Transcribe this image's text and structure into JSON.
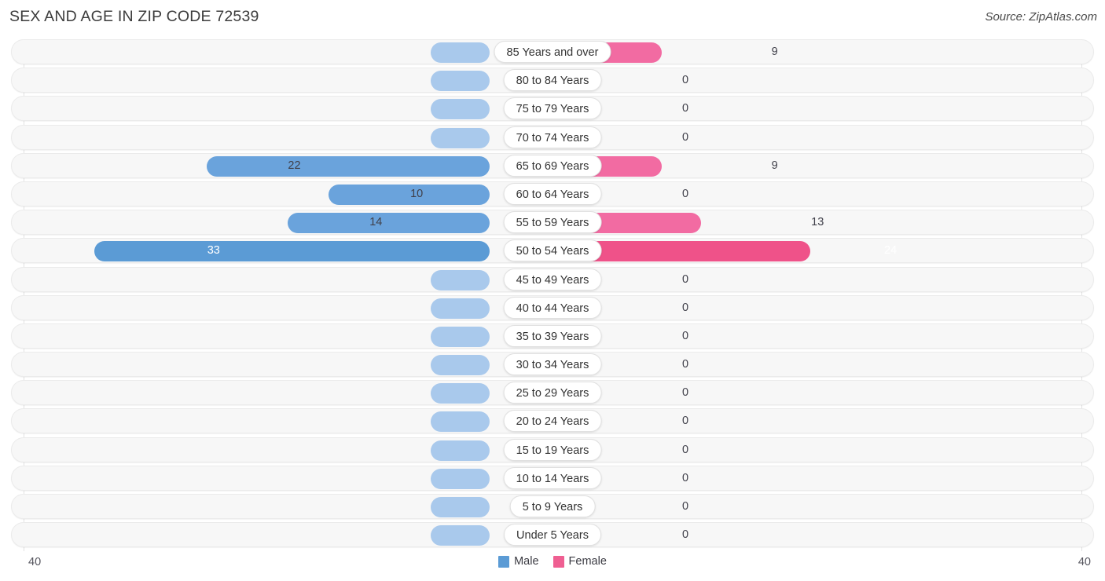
{
  "header": {
    "title": "SEX AND AGE IN ZIP CODE 72539",
    "source": "Source: ZipAtlas.com"
  },
  "legend": {
    "male_label": "Male",
    "female_label": "Female",
    "male_color": "#5b9bd5",
    "female_color": "#ef5f92"
  },
  "axis": {
    "left_max_label": "40",
    "right_max_label": "40"
  },
  "colors": {
    "male_strong": "#6aa3dc",
    "male_light": "#a9c9ec",
    "female_strong": "#f26ba2",
    "female_light": "#f7a9c4",
    "female_max": "#ef5289",
    "male_max": "#5b9bd5"
  },
  "chart_data": {
    "type": "bar",
    "title": "SEX AND AGE IN ZIP CODE 72539",
    "subtype": "population-pyramid",
    "xlabel": "",
    "ylabel": "",
    "xlim": [
      -40,
      40
    ],
    "axis_max": 40,
    "grid": false,
    "legend_position": "bottom-center",
    "categories": [
      "85 Years and over",
      "80 to 84 Years",
      "75 to 79 Years",
      "70 to 74 Years",
      "65 to 69 Years",
      "60 to 64 Years",
      "55 to 59 Years",
      "50 to 54 Years",
      "45 to 49 Years",
      "40 to 44 Years",
      "35 to 39 Years",
      "30 to 34 Years",
      "25 to 29 Years",
      "20 to 24 Years",
      "15 to 19 Years",
      "10 to 14 Years",
      "5 to 9 Years",
      "Under 5 Years"
    ],
    "series": [
      {
        "name": "Male",
        "values": [
          0,
          0,
          0,
          0,
          22,
          10,
          14,
          33,
          0,
          0,
          0,
          0,
          0,
          0,
          0,
          0,
          0,
          0
        ]
      },
      {
        "name": "Female",
        "values": [
          9,
          0,
          0,
          0,
          9,
          0,
          13,
          24,
          0,
          0,
          0,
          0,
          0,
          0,
          0,
          0,
          0,
          0
        ]
      }
    ]
  },
  "rows": [
    {
      "label": "85 Years and over",
      "male": "0",
      "female": "9"
    },
    {
      "label": "80 to 84 Years",
      "male": "0",
      "female": "0"
    },
    {
      "label": "75 to 79 Years",
      "male": "0",
      "female": "0"
    },
    {
      "label": "70 to 74 Years",
      "male": "0",
      "female": "0"
    },
    {
      "label": "65 to 69 Years",
      "male": "22",
      "female": "9"
    },
    {
      "label": "60 to 64 Years",
      "male": "10",
      "female": "0"
    },
    {
      "label": "55 to 59 Years",
      "male": "14",
      "female": "13"
    },
    {
      "label": "50 to 54 Years",
      "male": "33",
      "female": "24"
    },
    {
      "label": "45 to 49 Years",
      "male": "0",
      "female": "0"
    },
    {
      "label": "40 to 44 Years",
      "male": "0",
      "female": "0"
    },
    {
      "label": "35 to 39 Years",
      "male": "0",
      "female": "0"
    },
    {
      "label": "30 to 34 Years",
      "male": "0",
      "female": "0"
    },
    {
      "label": "25 to 29 Years",
      "male": "0",
      "female": "0"
    },
    {
      "label": "20 to 24 Years",
      "male": "0",
      "female": "0"
    },
    {
      "label": "15 to 19 Years",
      "male": "0",
      "female": "0"
    },
    {
      "label": "10 to 14 Years",
      "male": "0",
      "female": "0"
    },
    {
      "label": "5 to 9 Years",
      "male": "0",
      "female": "0"
    },
    {
      "label": "Under 5 Years",
      "male": "0",
      "female": "0"
    }
  ]
}
